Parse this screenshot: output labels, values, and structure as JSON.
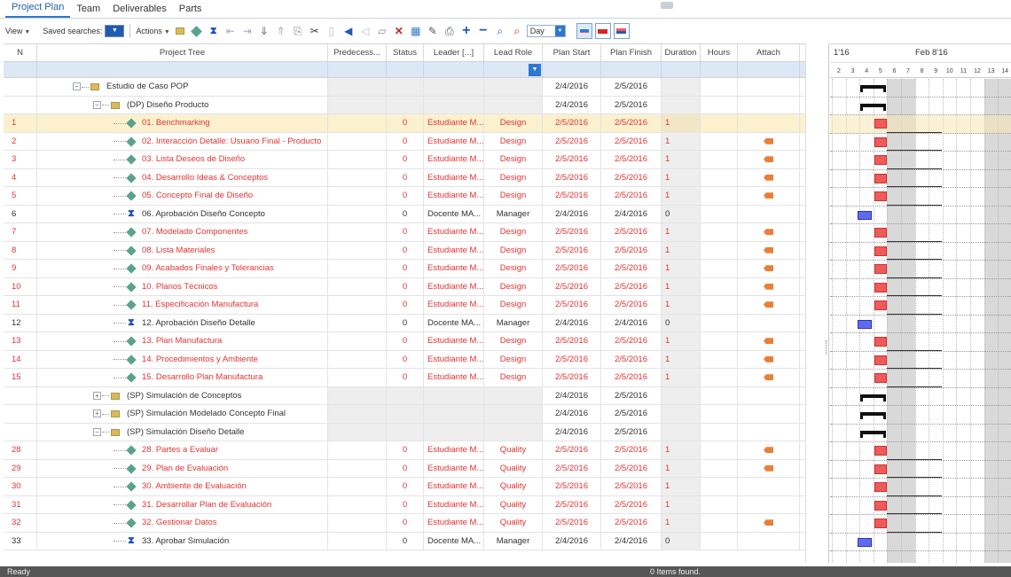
{
  "tabs": [
    "Project Plan",
    "Team",
    "Deliverables",
    "Parts"
  ],
  "toolbar": {
    "view_label": "View",
    "saved_label": "Saved searches:",
    "actions_label": "Actions",
    "zoom_value": "Day",
    "icons": [
      "summary-task-icon",
      "milestone-icon",
      "hourglass-icon",
      "outdent-icon",
      "indent-icon",
      "move-down-icon",
      "move-up-icon",
      "copy-icon",
      "cut-icon",
      "paste-icon",
      "flag-left-icon",
      "tag-icon",
      "new-document-icon",
      "delete-icon",
      "calendar-icon",
      "edit-icon",
      "print-icon",
      "zoom-in-icon",
      "zoom-out-icon",
      "find-icon",
      "find-red-icon"
    ]
  },
  "columns": {
    "n": "N",
    "tree": "Project Tree",
    "pred": "Predecess...",
    "status": "Status",
    "leader": "Leader [...]",
    "role": "Lead Role",
    "start": "Plan Start",
    "finish": "Plan Finish",
    "dur": "Duration",
    "hours": "Hours",
    "attach": "Attach"
  },
  "rows": [
    {
      "n": "",
      "name": "Estudio de Caso POP",
      "type": "summary",
      "level": 0,
      "exp": "−",
      "status": "",
      "leader": "",
      "role": "",
      "start": "2/4/2016",
      "finish": "2/5/2016",
      "dur": "",
      "attach": false
    },
    {
      "n": "",
      "name": "(DP) Diseño Producto",
      "type": "summary",
      "level": 1,
      "exp": "−",
      "status": "",
      "leader": "",
      "role": "",
      "start": "2/4/2016",
      "finish": "2/5/2016",
      "dur": "",
      "attach": false
    },
    {
      "n": "1",
      "name": "01. Benchmarking",
      "type": "task",
      "level": 2,
      "status": "0",
      "leader": "Estudiante M...",
      "role": "Design",
      "start": "2/5/2016",
      "finish": "2/5/2016",
      "dur": "1",
      "attach": false,
      "selected": true
    },
    {
      "n": "2",
      "name": "02. Interacción Detalle: Usuario Final - Producto",
      "type": "task",
      "level": 2,
      "status": "0",
      "leader": "Estudiante M...",
      "role": "Design",
      "start": "2/5/2016",
      "finish": "2/5/2016",
      "dur": "1",
      "attach": true
    },
    {
      "n": "3",
      "name": "03. Lista Deseos de Diseño",
      "type": "task",
      "level": 2,
      "status": "0",
      "leader": "Estudiante M...",
      "role": "Design",
      "start": "2/5/2016",
      "finish": "2/5/2016",
      "dur": "1",
      "attach": true
    },
    {
      "n": "4",
      "name": "04. Desarrollo Ideas & Conceptos",
      "type": "task",
      "level": 2,
      "status": "0",
      "leader": "Estudiante M...",
      "role": "Design",
      "start": "2/5/2016",
      "finish": "2/5/2016",
      "dur": "1",
      "attach": true
    },
    {
      "n": "5",
      "name": "05. Concepto Final de Diseño",
      "type": "task",
      "level": 2,
      "status": "0",
      "leader": "Estudiante M...",
      "role": "Design",
      "start": "2/5/2016",
      "finish": "2/5/2016",
      "dur": "1",
      "attach": true
    },
    {
      "n": "6",
      "name": "06. Aprobación Diseño Concepto",
      "type": "milestone",
      "level": 2,
      "status": "0",
      "leader": "Docente MA...",
      "role": "Manager",
      "start": "2/4/2016",
      "finish": "2/4/2016",
      "dur": "0",
      "attach": false
    },
    {
      "n": "7",
      "name": "07. Modelado Componentes",
      "type": "task",
      "level": 2,
      "status": "0",
      "leader": "Estudiante M...",
      "role": "Design",
      "start": "2/5/2016",
      "finish": "2/5/2016",
      "dur": "1",
      "attach": true
    },
    {
      "n": "8",
      "name": "08. Lista Materiales",
      "type": "task",
      "level": 2,
      "status": "0",
      "leader": "Estudiante M...",
      "role": "Design",
      "start": "2/5/2016",
      "finish": "2/5/2016",
      "dur": "1",
      "attach": true
    },
    {
      "n": "9",
      "name": "09. Acabados Finales y Tolerancias",
      "type": "task",
      "level": 2,
      "status": "0",
      "leader": "Estudiante M...",
      "role": "Design",
      "start": "2/5/2016",
      "finish": "2/5/2016",
      "dur": "1",
      "attach": true
    },
    {
      "n": "10",
      "name": "10. Planos Técnicos",
      "type": "task",
      "level": 2,
      "status": "0",
      "leader": "Estudiante M...",
      "role": "Design",
      "start": "2/5/2016",
      "finish": "2/5/2016",
      "dur": "1",
      "attach": true
    },
    {
      "n": "11",
      "name": "11. Especificación Manufactura",
      "type": "task",
      "level": 2,
      "status": "0",
      "leader": "Estudiante M...",
      "role": "Design",
      "start": "2/5/2016",
      "finish": "2/5/2016",
      "dur": "1",
      "attach": true
    },
    {
      "n": "12",
      "name": "12. Aprobación Diseño Detalle",
      "type": "milestone",
      "level": 2,
      "status": "0",
      "leader": "Docente MA...",
      "role": "Manager",
      "start": "2/4/2016",
      "finish": "2/4/2016",
      "dur": "0",
      "attach": false
    },
    {
      "n": "13",
      "name": "13. Plan Manufactura",
      "type": "task",
      "level": 2,
      "status": "0",
      "leader": "Estudiante M...",
      "role": "Design",
      "start": "2/5/2016",
      "finish": "2/5/2016",
      "dur": "1",
      "attach": true
    },
    {
      "n": "14",
      "name": "14. Procedimientos y Ambiente",
      "type": "task",
      "level": 2,
      "status": "0",
      "leader": "Estudiante M...",
      "role": "Design",
      "start": "2/5/2016",
      "finish": "2/5/2016",
      "dur": "1",
      "attach": true
    },
    {
      "n": "15",
      "name": "15. Desarrollo Plan Manufactura",
      "type": "task",
      "level": 2,
      "status": "0",
      "leader": "Estudiante M...",
      "role": "Design",
      "start": "2/5/2016",
      "finish": "2/5/2016",
      "dur": "1",
      "attach": true
    },
    {
      "n": "",
      "name": "(SP) Simulación de Conceptos",
      "type": "summary",
      "level": 1,
      "exp": "+",
      "status": "",
      "leader": "",
      "role": "",
      "start": "2/4/2016",
      "finish": "2/5/2016",
      "dur": "",
      "attach": false
    },
    {
      "n": "",
      "name": "(SP) Simulación Modelado Concepto Final",
      "type": "summary",
      "level": 1,
      "exp": "+",
      "status": "",
      "leader": "",
      "role": "",
      "start": "2/4/2016",
      "finish": "2/5/2016",
      "dur": "",
      "attach": false
    },
    {
      "n": "",
      "name": "(SP) Simulación Diseño Detalle",
      "type": "summary",
      "level": 1,
      "exp": "−",
      "status": "",
      "leader": "",
      "role": "",
      "start": "2/4/2016",
      "finish": "2/5/2016",
      "dur": "",
      "attach": false
    },
    {
      "n": "28",
      "name": "28. Partes a Evaluar",
      "type": "task",
      "level": 2,
      "status": "0",
      "leader": "Estudiante M...",
      "role": "Quality",
      "start": "2/5/2016",
      "finish": "2/5/2016",
      "dur": "1",
      "attach": true
    },
    {
      "n": "29",
      "name": "29. Plan de Evaluación",
      "type": "task",
      "level": 2,
      "status": "0",
      "leader": "Estudiante M...",
      "role": "Quality",
      "start": "2/5/2016",
      "finish": "2/5/2016",
      "dur": "1",
      "attach": true
    },
    {
      "n": "30",
      "name": "30. Ambiente de Evaluación",
      "type": "task",
      "level": 2,
      "status": "0",
      "leader": "Estudiante M...",
      "role": "Quality",
      "start": "2/5/2016",
      "finish": "2/5/2016",
      "dur": "1",
      "attach": false
    },
    {
      "n": "31",
      "name": "31. Desarrollar Plan de Evaluación",
      "type": "task",
      "level": 2,
      "status": "0",
      "leader": "Estudiante M...",
      "role": "Quality",
      "start": "2/5/2016",
      "finish": "2/5/2016",
      "dur": "1",
      "attach": false
    },
    {
      "n": "32",
      "name": "32. Gestionar Datos",
      "type": "task",
      "level": 2,
      "status": "0",
      "leader": "Estudiante M...",
      "role": "Quality",
      "start": "2/5/2016",
      "finish": "2/5/2016",
      "dur": "1",
      "attach": true
    },
    {
      "n": "33",
      "name": "33. Aprobar Simulación",
      "type": "milestone",
      "level": 2,
      "status": "0",
      "leader": "Docente MA...",
      "role": "Manager",
      "start": "2/4/2016",
      "finish": "2/4/2016",
      "dur": "0",
      "attach": false
    }
  ],
  "gantt": {
    "weeks": [
      "1'16",
      "Feb 8'16"
    ],
    "days": [
      "2",
      "3",
      "4",
      "5",
      "6",
      "7",
      "8",
      "9",
      "10",
      "11",
      "12",
      "13",
      "14"
    ],
    "weekend_days": [
      "6",
      "7",
      "13",
      "14"
    ]
  },
  "statusbar": {
    "left": "Ready",
    "center": "0 Items found."
  },
  "colors": {
    "task_text": "#e23333",
    "accent": "#2c78d2",
    "task_bar": "#ef5a5a",
    "milestone_bar": "#5c6cf0",
    "attach_flag": "#e9803a"
  }
}
